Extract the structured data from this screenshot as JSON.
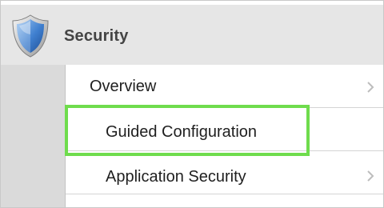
{
  "header": {
    "title": "Security",
    "icon": "shield-icon"
  },
  "menu": {
    "items": [
      {
        "label": "Overview",
        "icon": "chevron-right-icon"
      },
      {
        "label": "Guided Configuration"
      },
      {
        "label": "Application Security",
        "icon": "chevron-right-icon"
      }
    ],
    "highlighted_item": "Guided Configuration"
  },
  "colors": {
    "highlight": "#6fdc4d",
    "shield_blue": "#3f7fcf",
    "background": "#e6e6e6"
  }
}
